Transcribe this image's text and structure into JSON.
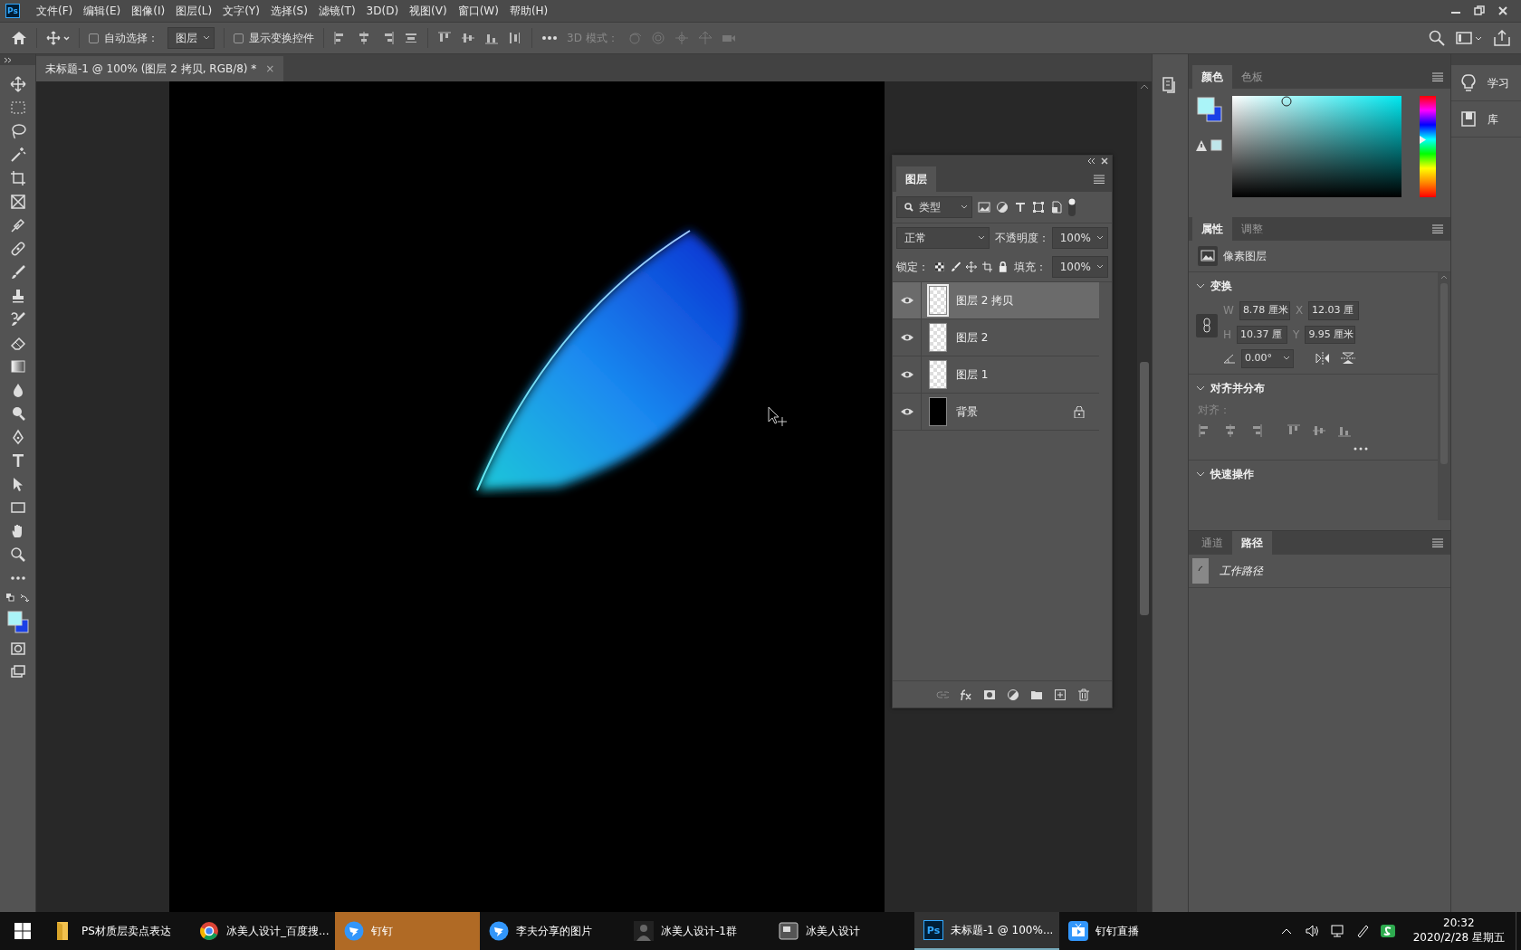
{
  "app": {
    "logo": "Ps"
  },
  "menu": [
    "文件(F)",
    "编辑(E)",
    "图像(I)",
    "图层(L)",
    "文字(Y)",
    "选择(S)",
    "滤镜(T)",
    "3D(D)",
    "视图(V)",
    "窗口(W)",
    "帮助(H)"
  ],
  "options": {
    "auto_select": {
      "label": "自动选择：",
      "checked": false
    },
    "target": "图层",
    "transform_controls": {
      "label": "显示变换控件",
      "checked": false
    },
    "mode_3d": "3D 模式："
  },
  "document_tab": {
    "title": "未标题-1 @ 100% (图层 2 拷贝, RGB/8) *",
    "close": "×"
  },
  "layers_panel": {
    "tab": "图层",
    "filter": "类型",
    "blend_mode": "正常",
    "opacity_label": "不透明度：",
    "opacity": "100%",
    "lock_label": "锁定：",
    "fill_label": "填充：",
    "fill": "100%",
    "layers": [
      {
        "name": "图层 2 拷贝",
        "selected": true,
        "visible": true,
        "locked": false,
        "kind": "pixel"
      },
      {
        "name": "图层 2",
        "selected": false,
        "visible": true,
        "locked": false,
        "kind": "pixel"
      },
      {
        "name": "图层 1",
        "selected": false,
        "visible": true,
        "locked": false,
        "kind": "pixel"
      },
      {
        "name": "背景",
        "selected": false,
        "visible": true,
        "locked": true,
        "kind": "background"
      }
    ]
  },
  "color_panel": {
    "hue": {
      "level": 0.57
    },
    "tabs": [
      {
        "label": "颜色",
        "selected": true
      },
      {
        "label": "色板",
        "selected": false
      }
    ]
  },
  "properties_panel": {
    "tabs": [
      {
        "label": "属性",
        "selected": true
      },
      {
        "label": "调整",
        "selected": false
      }
    ],
    "layer_type": "像素图层",
    "transform": {
      "title": "变换",
      "expanded": true,
      "w_label": "W",
      "w": "8.78 厘米",
      "x_label": "X",
      "x": "12.03 厘",
      "h_label": "H",
      "h": "10.37 厘",
      "y_label": "Y",
      "y": "9.95 厘米",
      "angle": "0.00°"
    },
    "align": {
      "title": "对齐并分布",
      "expanded": true,
      "label": "对齐："
    },
    "quick_actions": {
      "title": "快速操作",
      "expanded": true
    }
  },
  "paths_panel": {
    "tabs": [
      {
        "label": "通道",
        "selected": false
      },
      {
        "label": "路径",
        "selected": true
      }
    ],
    "paths": [
      {
        "name": "工作路径"
      }
    ]
  },
  "side_panels": [
    {
      "label": "学习",
      "kind": "learn"
    },
    {
      "label": "库",
      "kind": "library"
    }
  ],
  "taskbar": {
    "items": [
      {
        "label": "PS材质层卖点表达",
        "kind": "folder",
        "flashing": false,
        "selected": false
      },
      {
        "label": "冰美人设计_百度搜...",
        "kind": "browser",
        "flashing": false,
        "selected": false
      },
      {
        "label": "钉钉",
        "kind": "chat",
        "flashing": true,
        "selected": false
      },
      {
        "label": "李夫分享的图片",
        "kind": "chat",
        "flashing": false,
        "selected": false
      },
      {
        "label": "冰美人设计-1群",
        "kind": "avatar",
        "flashing": false,
        "selected": false
      },
      {
        "label": "冰美人设计",
        "kind": "app",
        "flashing": false,
        "selected": false
      },
      {
        "label": "未标题-1 @ 100%...",
        "kind": "ps",
        "icon_text": "Ps",
        "flashing": false,
        "selected": true
      },
      {
        "label": "钉钉直播",
        "kind": "live",
        "flashing": false,
        "selected": false
      }
    ],
    "time": "20:32",
    "date": "2020/2/28 星期五"
  }
}
